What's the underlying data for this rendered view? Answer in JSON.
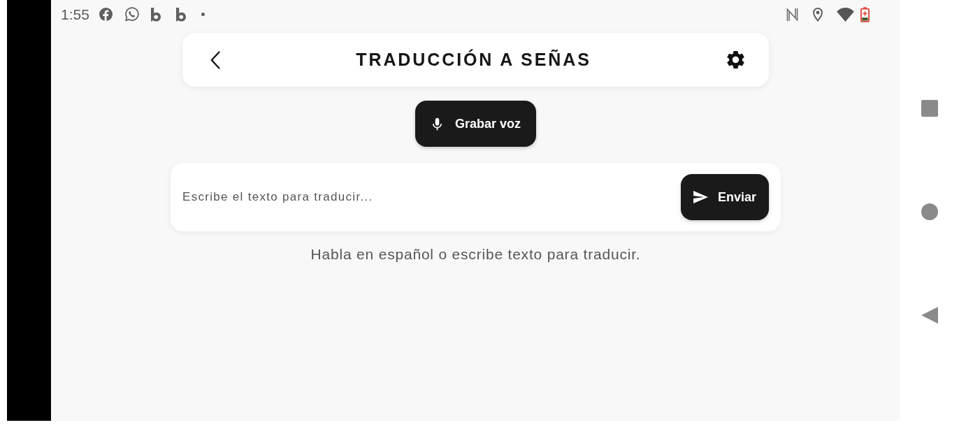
{
  "status_bar": {
    "time": "1:55"
  },
  "header": {
    "title": "TRADUCCIÓN A SEÑAS"
  },
  "voice_button": {
    "label": "Grabar voz"
  },
  "text_input": {
    "placeholder": "Escribe el texto para traducir..."
  },
  "send_button": {
    "label": "Enviar"
  },
  "hint": "Habla en español o escribe texto para traducir."
}
